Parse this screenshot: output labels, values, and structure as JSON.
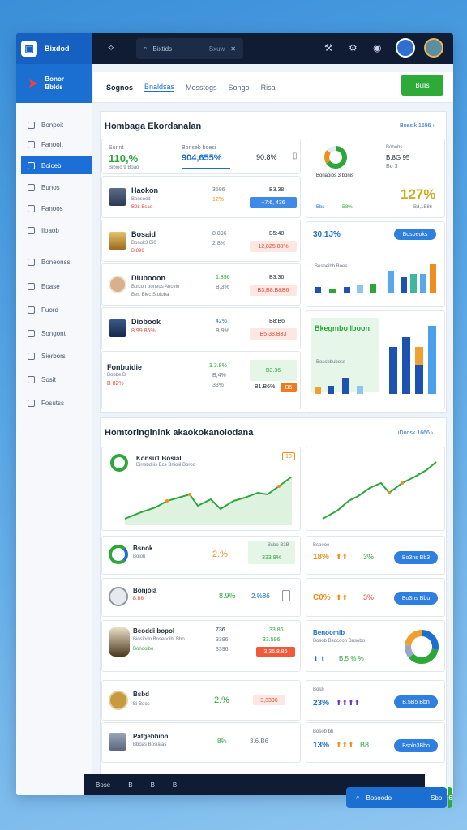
{
  "topbar": {
    "brand": "Bixdod",
    "search_text": "Bixtids",
    "search_hint": "Sxuw",
    "icons": [
      "sparkle-icon",
      "grid-icon",
      "settings-icon",
      "notification-icon"
    ]
  },
  "sidebar": {
    "brand_line1": "Bonor",
    "brand_line2": "Bblds",
    "items": [
      {
        "label": "Bonpoit",
        "icon": "home-icon"
      },
      {
        "label": "Fanooit",
        "icon": "folder-icon"
      },
      {
        "label": "Boiceb",
        "icon": "chart-icon"
      },
      {
        "label": "Bunos",
        "icon": "list-icon"
      },
      {
        "label": "Fanoos",
        "icon": "calendar-icon"
      },
      {
        "label": "Iloaob",
        "icon": "users-icon"
      },
      {
        "label": "Boneonss",
        "icon": "message-icon"
      },
      {
        "label": "Eoase",
        "icon": "doc-icon"
      },
      {
        "label": "Fuord",
        "icon": "box-icon"
      },
      {
        "label": "Songont",
        "icon": "settings-icon"
      },
      {
        "label": "Sierbors",
        "icon": "tools-icon"
      },
      {
        "label": "Sosit",
        "icon": "help-icon"
      },
      {
        "label": "Fosutss",
        "icon": "logout-icon"
      }
    ]
  },
  "subbar": {
    "tabs": [
      "Sognos",
      "Bnaldsas",
      "Mosstogs",
      "Songo",
      "Risa"
    ],
    "button": "Bulis"
  },
  "section1": {
    "title": "Hombaga Ekordanalan",
    "link": "Boesik 1696 ›",
    "stat1_label": "Sonnt",
    "stat1_value": "110,%",
    "stat1_sub": "Bibioo 9 Boao",
    "stat2_label": "Bonseb boesi",
    "stat2_value": "904,655%",
    "stat3_value": "90.8%",
    "rows": [
      {
        "name": "Haokon",
        "sub": "Bonsooit",
        "sub2": "B28 Bsae",
        "v1": "3596",
        "v2": "12%",
        "v3": "B3.38",
        "tag": "+7:6, 436"
      },
      {
        "name": "Bosaid",
        "sub": "Bonol:3 Bi0",
        "sub2": "B:896",
        "v1": "8.896",
        "v2": "2.8%",
        "v3": "B5:48",
        "tag": "12,825.88%"
      },
      {
        "name": "Diubooon",
        "sub": "Boicon boneos Ancelo",
        "sub2": "Ber: Biec Stoioba",
        "g1": "1.896",
        "v1": "B.3%",
        "v2": "",
        "v3": "B3.36",
        "tag": "B3,B8:B&B6"
      },
      {
        "name": "Diobook",
        "sub": "8.99 85%",
        "sub2": "",
        "v1": "42%",
        "v2": "B.9%",
        "v3": "B8:B6",
        "tag": "B5,38,B33"
      },
      {
        "name": "Fonbuidie",
        "sub": "Bobbe B",
        "sub2": "B 82%",
        "v1": "3.3.8%",
        "v2": "B,4%",
        "v3": "33%",
        "v4": "B3.36",
        "tag": "B1.B6%",
        "tag2": "B6"
      }
    ],
    "right": {
      "donut_label": "Bonaoibs 3 bonis",
      "r_label1": "Bobobs",
      "r_val1": "B,8G 95",
      "r_val2": "Bo 3",
      "r_big": "127%",
      "r_small": "Bd,1B86",
      "r_leg1": "Bbs",
      "r_leg2": "B8%",
      "bar_val": "30,1J%",
      "bar_btn": "Bosbeoks",
      "bar_lbl": "Bosoeibb Boes",
      "chart2_title": "Bkegmbo Iboon",
      "chart2_sub": "Bossbbuboss"
    }
  },
  "section2": {
    "title": "Homtoringlnink akaokokanolodana",
    "link": "iDoosk 1666 ›",
    "chart_title": "Konsu1 Bosial",
    "chart_sub": "Birrsbdiiis Ecs Bnioiil Boroo",
    "chart_tag": "13",
    "rows": [
      {
        "name": "Bsnok",
        "sub": "Boiob",
        "val": "2.%",
        "tag_top": "Bsbo B3B",
        "tag": "333.9%",
        "r_head": "Bsbooe",
        "r_val": "18%",
        "r_val2": "3%",
        "btn": "Bo3ns Bb3"
      },
      {
        "name": "Bonjoia",
        "sub": "B:B6",
        "val": "8.9%",
        "tag": "2.%86",
        "r_val": "C0%",
        "r_val2": "3%",
        "btn": "Bo3ns Bbu"
      },
      {
        "name": "Beoddi bopol",
        "sub": "Biosibdo Boseooib. Bbo",
        "sub2": "Bonooibo",
        "v1": "736",
        "v2": "3396",
        "v3": "3396",
        "g1": "33.86",
        "g2": "33.596",
        "tag": "3.36.8.86",
        "r_title": "Benoomib",
        "r_sub": "Bosob Bsocoon Busobo",
        "r_val": "B.5 % %"
      },
      {
        "name": "Bsbd",
        "sub": "Bi Boos",
        "val": "2.%",
        "tag": "3,3396",
        "r_head": "Bosb",
        "r_val": "23%",
        "btn": "B,5B5 Bbn"
      },
      {
        "name": "Pafgebbion",
        "sub": "Bboas Bosiaias",
        "val": "8%",
        "tag": "3.6.B6",
        "r_head": "Bosob bb",
        "r_val": "13%",
        "r_val2": "B8",
        "btn": "Bsolo3Bbo"
      }
    ]
  },
  "bottom": {
    "items": [
      "Bose",
      "B",
      "B",
      "B"
    ],
    "float_label": "Bosoodo",
    "float_val": "Sbo",
    "float_btn": "6"
  },
  "colors": {
    "accent": "#1b6fd0",
    "green": "#2ca83a",
    "red": "#e24a3a",
    "orange": "#f08e1d",
    "dark": "#0f1c33"
  }
}
